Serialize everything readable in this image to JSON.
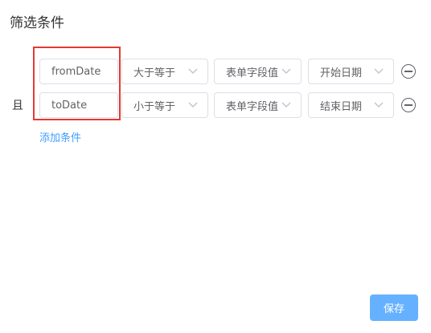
{
  "dialog": {
    "title": "筛选条件",
    "logic_label": "且",
    "add_condition_label": "添加条件",
    "save_label": "保存"
  },
  "conditions": [
    {
      "field": "fromDate",
      "operator": "大于等于",
      "value_type": "表单字段值",
      "value": "开始日期"
    },
    {
      "field": "toDate",
      "operator": "小于等于",
      "value_type": "表单字段值",
      "value": "结束日期"
    }
  ],
  "colors": {
    "accent": "#409eff",
    "save_button": "#66b1ff",
    "highlight_border": "#e53935"
  }
}
